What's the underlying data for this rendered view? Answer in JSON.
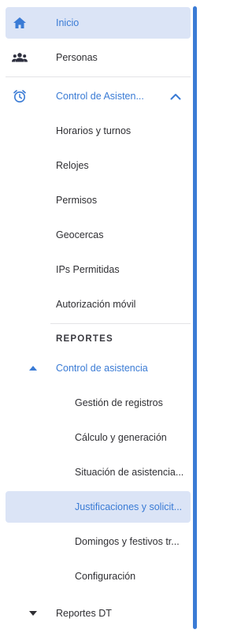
{
  "nav": {
    "inicio": "Inicio",
    "personas": "Personas",
    "control_asistencia": "Control de Asisten...",
    "horarios": "Horarios y turnos",
    "relojes": "Relojes",
    "permisos": "Permisos",
    "geocercas": "Geocercas",
    "ips": "IPs Permitidas",
    "autorizacion": "Autorización móvil"
  },
  "reportes": {
    "title": "REPORTES",
    "control": "Control de asistencia",
    "gestion": "Gestión de registros",
    "calculo": "Cálculo y generación",
    "situacion": "Situación de asistencia...",
    "justificaciones": "Justificaciones y solicit...",
    "domingos": "Domingos y festivos tr...",
    "configuracion": "Configuración",
    "reportes_dt": "Reportes DT"
  },
  "colors": {
    "accent": "#3a7bd5",
    "active_bg": "#dbe4f6",
    "text": "#2f2f33"
  },
  "icons": [
    "home-icon",
    "people-icon",
    "alarm-clock-icon",
    "chevron-up-icon",
    "caret-up-icon",
    "caret-down-icon"
  ]
}
